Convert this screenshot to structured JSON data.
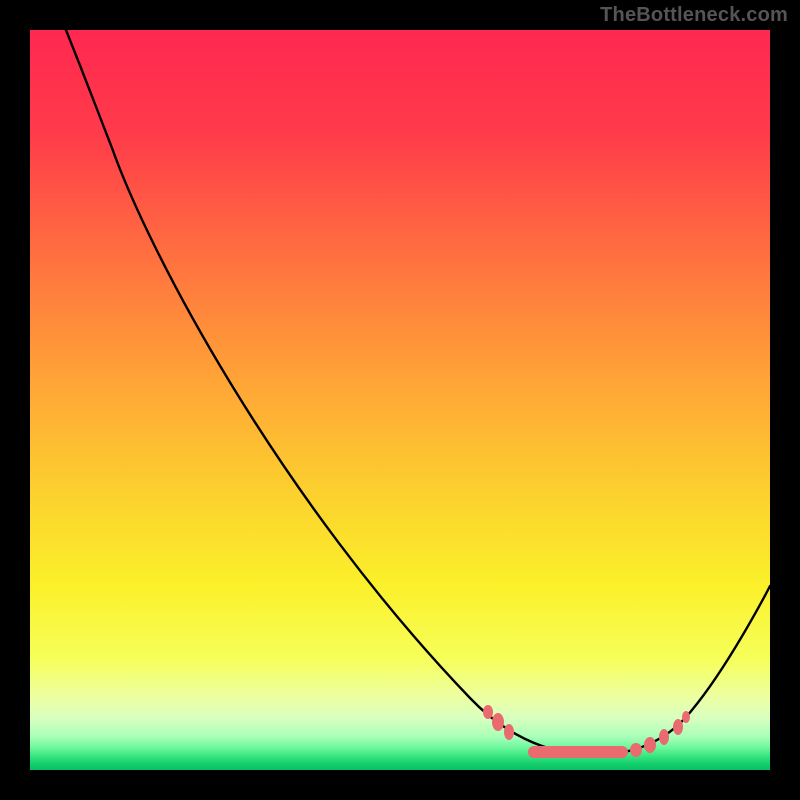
{
  "attribution": "TheBottleneck.com",
  "colors": {
    "frame": "#000000",
    "gradient_top": "#ff2850",
    "gradient_mid": "#fbf02a",
    "gradient_bottom": "#08c060",
    "curve": "#000000",
    "marker": "#e96a6f"
  },
  "chart_data": {
    "type": "line",
    "title": "",
    "xlabel": "",
    "ylabel": "",
    "xlim": [
      0,
      100
    ],
    "ylim": [
      0,
      100
    ],
    "grid": false,
    "legend": false,
    "series": [
      {
        "name": "bottleneck-curve",
        "x": [
          5,
          11,
          20,
          30,
          40,
          50,
          59,
          65,
          69,
          73,
          77,
          81,
          85,
          89,
          93,
          97,
          100
        ],
        "y": [
          100,
          84,
          65,
          48,
          33,
          20,
          10,
          6,
          4,
          2.5,
          2,
          2,
          2.5,
          4,
          8,
          16,
          25
        ]
      }
    ],
    "markers": {
      "name": "valley-markers",
      "x": [
        62,
        63,
        65,
        72,
        82,
        84,
        86,
        88,
        89
      ],
      "y": [
        8,
        6.5,
        5,
        3,
        2.7,
        3.3,
        4.5,
        6,
        7
      ]
    },
    "background": {
      "type": "vertical-gradient",
      "stops": [
        {
          "pct": 0,
          "color": "#ff2850"
        },
        {
          "pct": 48,
          "color": "#ffa636"
        },
        {
          "pct": 75,
          "color": "#fbf02a"
        },
        {
          "pct": 93,
          "color": "#d8ffc0"
        },
        {
          "pct": 100,
          "color": "#08c060"
        }
      ]
    }
  }
}
